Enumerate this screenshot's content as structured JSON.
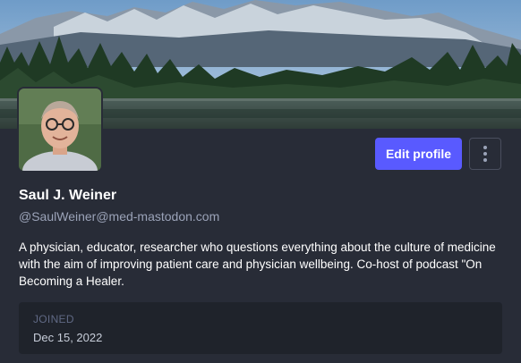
{
  "profile": {
    "display_name": "Saul J. Weiner",
    "handle": "@SaulWeiner@med-mastodon.com",
    "bio": "A physician, educator, researcher who questions everything about the culture of medicine with the aim of improving patient care and physician wellbeing. Co-host of podcast \"On Becoming a Healer.",
    "joined_label": "JOINED",
    "joined_date": "Dec 15, 2022"
  },
  "actions": {
    "edit_label": "Edit profile",
    "more_icon": "vertical-ellipsis-icon"
  },
  "colors": {
    "background": "#282c37",
    "accent": "#595aff",
    "joined_box": "#1f232b"
  }
}
